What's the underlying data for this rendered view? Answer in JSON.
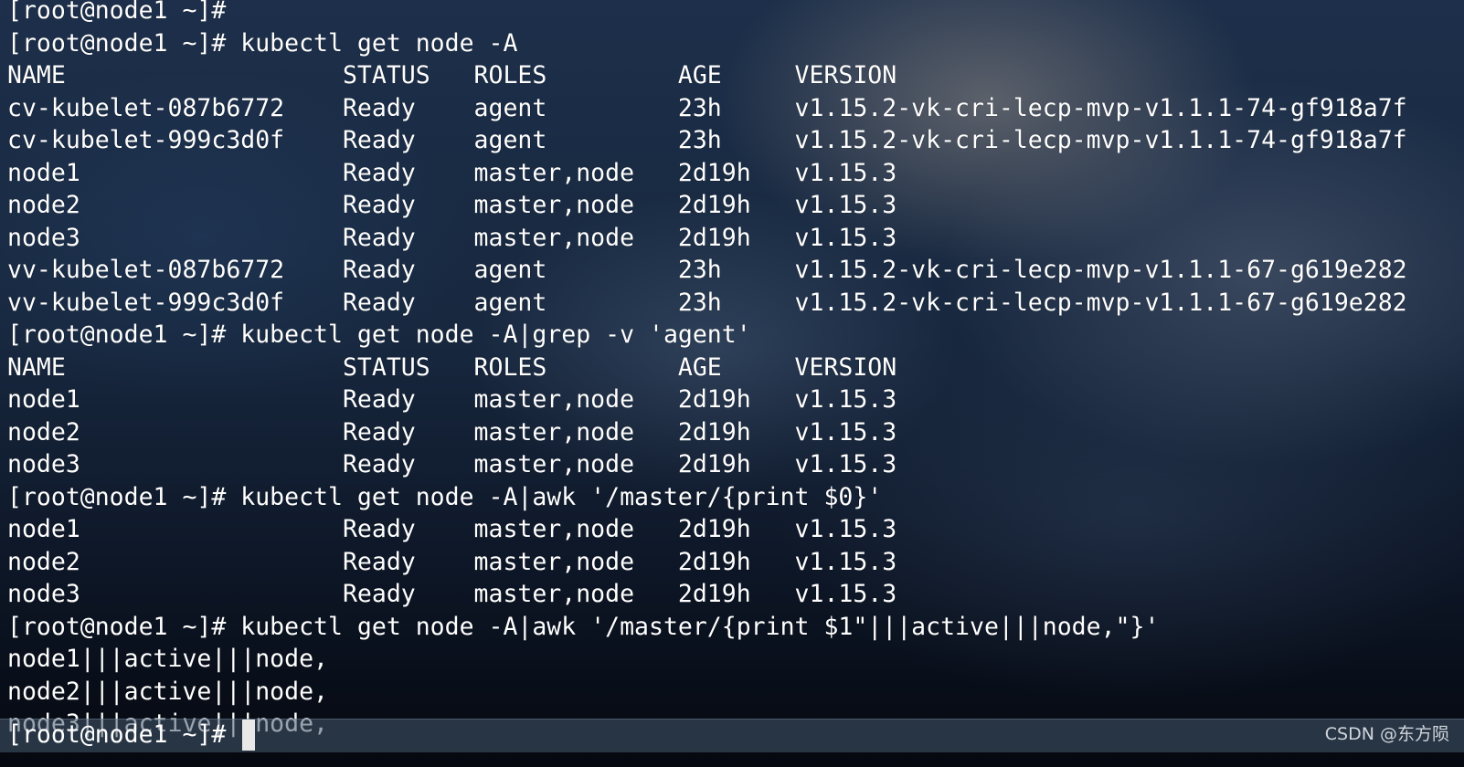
{
  "terminal": {
    "lines": [
      "[root@node1 ~]#",
      "[root@node1 ~]# kubectl get node -A",
      "NAME                   STATUS   ROLES         AGE     VERSION",
      "cv-kubelet-087b6772    Ready    agent         23h     v1.15.2-vk-cri-lecp-mvp-v1.1.1-74-gf918a7f",
      "cv-kubelet-999c3d0f    Ready    agent         23h     v1.15.2-vk-cri-lecp-mvp-v1.1.1-74-gf918a7f",
      "node1                  Ready    master,node   2d19h   v1.15.3",
      "node2                  Ready    master,node   2d19h   v1.15.3",
      "node3                  Ready    master,node   2d19h   v1.15.3",
      "vv-kubelet-087b6772    Ready    agent         23h     v1.15.2-vk-cri-lecp-mvp-v1.1.1-67-g619e282",
      "vv-kubelet-999c3d0f    Ready    agent         23h     v1.15.2-vk-cri-lecp-mvp-v1.1.1-67-g619e282",
      "[root@node1 ~]# kubectl get node -A|grep -v 'agent'",
      "NAME                   STATUS   ROLES         AGE     VERSION",
      "node1                  Ready    master,node   2d19h   v1.15.3",
      "node2                  Ready    master,node   2d19h   v1.15.3",
      "node3                  Ready    master,node   2d19h   v1.15.3",
      "[root@node1 ~]# kubectl get node -A|awk '/master/{print $0}'",
      "node1                  Ready    master,node   2d19h   v1.15.3",
      "node2                  Ready    master,node   2d19h   v1.15.3",
      "node3                  Ready    master,node   2d19h   v1.15.3",
      "[root@node1 ~]# kubectl get node -A|awk '/master/{print $1\"|||active|||node,\"}'",
      "node1|||active|||node,",
      "node2|||active|||node,",
      "node3|||active|||node,"
    ],
    "prompt": "[root@node1 ~]# "
  },
  "watermark": "CSDN @东方陨"
}
